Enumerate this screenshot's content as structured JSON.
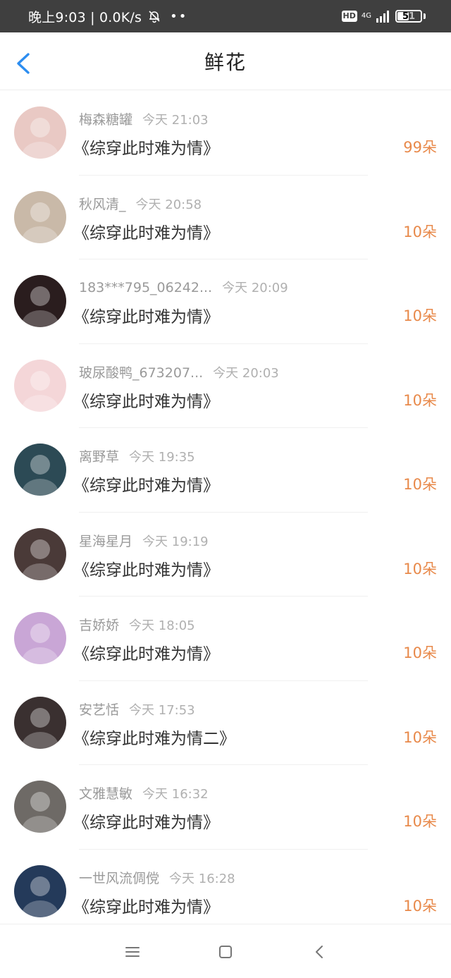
{
  "status_bar": {
    "time_text": "晚上9:03 | 0.0K/s",
    "dots": "••",
    "hd": "HD",
    "network": "4G",
    "battery": "51",
    "battery_level": 0.51
  },
  "header": {
    "title": "鲜花"
  },
  "colors": {
    "accent_blue": "#2c8df0",
    "count_orange": "#e8894a"
  },
  "items": [
    {
      "user": "梅森糖罐",
      "time": "今天 21:03",
      "book": "《综穿此时难为情》",
      "count": "99朵",
      "avatar_color": "#e9c9c4"
    },
    {
      "user": "秋风清_",
      "time": "今天 20:58",
      "book": "《综穿此时难为情》",
      "count": "10朵",
      "avatar_color": "#c9b9a8"
    },
    {
      "user": "183***795_06242...",
      "time": "今天 20:09",
      "book": "《综穿此时难为情》",
      "count": "10朵",
      "avatar_color": "#2a1d1e"
    },
    {
      "user": "玻尿酸鸭_673207...",
      "time": "今天 20:03",
      "book": "《综穿此时难为情》",
      "count": "10朵",
      "avatar_color": "#f4d6d8"
    },
    {
      "user": "离野草",
      "time": "今天 19:35",
      "book": "《综穿此时难为情》",
      "count": "10朵",
      "avatar_color": "#2c4a55"
    },
    {
      "user": "星海星月",
      "time": "今天 19:19",
      "book": "《综穿此时难为情》",
      "count": "10朵",
      "avatar_color": "#4a3a38"
    },
    {
      "user": "吉娇娇",
      "time": "今天 18:05",
      "book": "《综穿此时难为情》",
      "count": "10朵",
      "avatar_color": "#c9a6d6"
    },
    {
      "user": "安艺恬",
      "time": "今天 17:53",
      "book": "《综穿此时难为情二》",
      "count": "10朵",
      "avatar_color": "#3a3030"
    },
    {
      "user": "文雅慧敏",
      "time": "今天 16:32",
      "book": "《综穿此时难为情》",
      "count": "10朵",
      "avatar_color": "#6e6a66"
    },
    {
      "user": "一世风流倜傥",
      "time": "今天 16:28",
      "book": "《综穿此时难为情》",
      "count": "10朵",
      "avatar_color": "#243a5a"
    }
  ],
  "nav_bar": {
    "icons": [
      "menu-icon",
      "home-square-icon",
      "back-chevron-icon"
    ]
  }
}
